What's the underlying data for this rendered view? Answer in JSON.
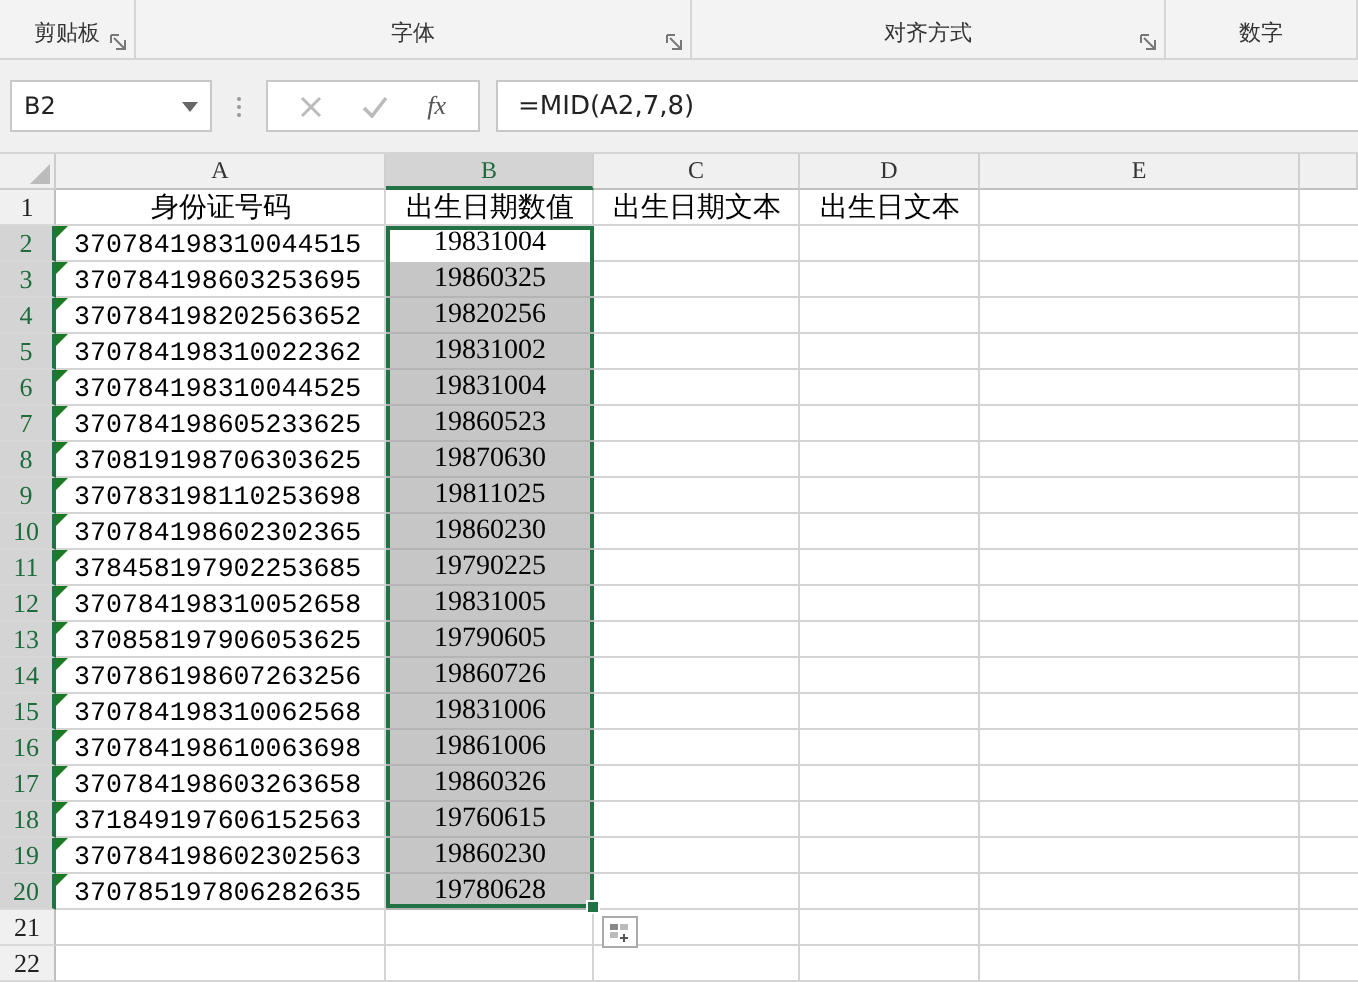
{
  "ribbon_groups": [
    {
      "label": "剪贴板",
      "launcher": true
    },
    {
      "label": "字体",
      "launcher": true
    },
    {
      "label": "对齐方式",
      "launcher": true
    },
    {
      "label": "数字",
      "launcher": false
    }
  ],
  "formula_bar": {
    "name_box": "B2",
    "fx": "fx",
    "formula": "=MID(A2,7,8)"
  },
  "columns": [
    {
      "label": "A",
      "selected": false
    },
    {
      "label": "B",
      "selected": true
    },
    {
      "label": "C",
      "selected": false
    },
    {
      "label": "D",
      "selected": false
    },
    {
      "label": "E",
      "selected": false
    }
  ],
  "rows": [
    {
      "number": "1",
      "selected": false,
      "error_flag": false,
      "cells": [
        "身份证号码",
        "出生日期数值",
        "出生日期文本",
        "出生日文本",
        ""
      ]
    },
    {
      "number": "2",
      "selected": true,
      "error_flag": true,
      "cells": [
        "370784198310044515",
        "19831004",
        "",
        "",
        ""
      ]
    },
    {
      "number": "3",
      "selected": true,
      "error_flag": true,
      "cells": [
        "370784198603253695",
        "19860325",
        "",
        "",
        ""
      ]
    },
    {
      "number": "4",
      "selected": true,
      "error_flag": true,
      "cells": [
        "370784198202563652",
        "19820256",
        "",
        "",
        ""
      ]
    },
    {
      "number": "5",
      "selected": true,
      "error_flag": true,
      "cells": [
        "370784198310022362",
        "19831002",
        "",
        "",
        ""
      ]
    },
    {
      "number": "6",
      "selected": true,
      "error_flag": true,
      "cells": [
        "370784198310044525",
        "19831004",
        "",
        "",
        ""
      ]
    },
    {
      "number": "7",
      "selected": true,
      "error_flag": true,
      "cells": [
        "370784198605233625",
        "19860523",
        "",
        "",
        ""
      ]
    },
    {
      "number": "8",
      "selected": true,
      "error_flag": true,
      "cells": [
        "370819198706303625",
        "19870630",
        "",
        "",
        ""
      ]
    },
    {
      "number": "9",
      "selected": true,
      "error_flag": true,
      "cells": [
        "370783198110253698",
        "19811025",
        "",
        "",
        ""
      ]
    },
    {
      "number": "10",
      "selected": true,
      "error_flag": true,
      "cells": [
        "370784198602302365",
        "19860230",
        "",
        "",
        ""
      ]
    },
    {
      "number": "11",
      "selected": true,
      "error_flag": true,
      "cells": [
        "378458197902253685",
        "19790225",
        "",
        "",
        ""
      ]
    },
    {
      "number": "12",
      "selected": true,
      "error_flag": true,
      "cells": [
        "370784198310052658",
        "19831005",
        "",
        "",
        ""
      ]
    },
    {
      "number": "13",
      "selected": true,
      "error_flag": true,
      "cells": [
        "370858197906053625",
        "19790605",
        "",
        "",
        ""
      ]
    },
    {
      "number": "14",
      "selected": true,
      "error_flag": true,
      "cells": [
        "370786198607263256",
        "19860726",
        "",
        "",
        ""
      ]
    },
    {
      "number": "15",
      "selected": true,
      "error_flag": true,
      "cells": [
        "370784198310062568",
        "19831006",
        "",
        "",
        ""
      ]
    },
    {
      "number": "16",
      "selected": true,
      "error_flag": true,
      "cells": [
        "370784198610063698",
        "19861006",
        "",
        "",
        ""
      ]
    },
    {
      "number": "17",
      "selected": true,
      "error_flag": true,
      "cells": [
        "370784198603263658",
        "19860326",
        "",
        "",
        ""
      ]
    },
    {
      "number": "18",
      "selected": true,
      "error_flag": true,
      "cells": [
        "371849197606152563",
        "19760615",
        "",
        "",
        ""
      ]
    },
    {
      "number": "19",
      "selected": true,
      "error_flag": true,
      "cells": [
        "370784198602302563",
        "19860230",
        "",
        "",
        ""
      ]
    },
    {
      "number": "20",
      "selected": true,
      "error_flag": true,
      "cells": [
        "370785197806282635",
        "19780628",
        "",
        "",
        ""
      ]
    },
    {
      "number": "21",
      "selected": false,
      "error_flag": false,
      "cells": [
        "",
        "",
        "",
        "",
        ""
      ]
    },
    {
      "number": "22",
      "selected": false,
      "error_flag": false,
      "cells": [
        "",
        "",
        "",
        "",
        ""
      ]
    }
  ]
}
